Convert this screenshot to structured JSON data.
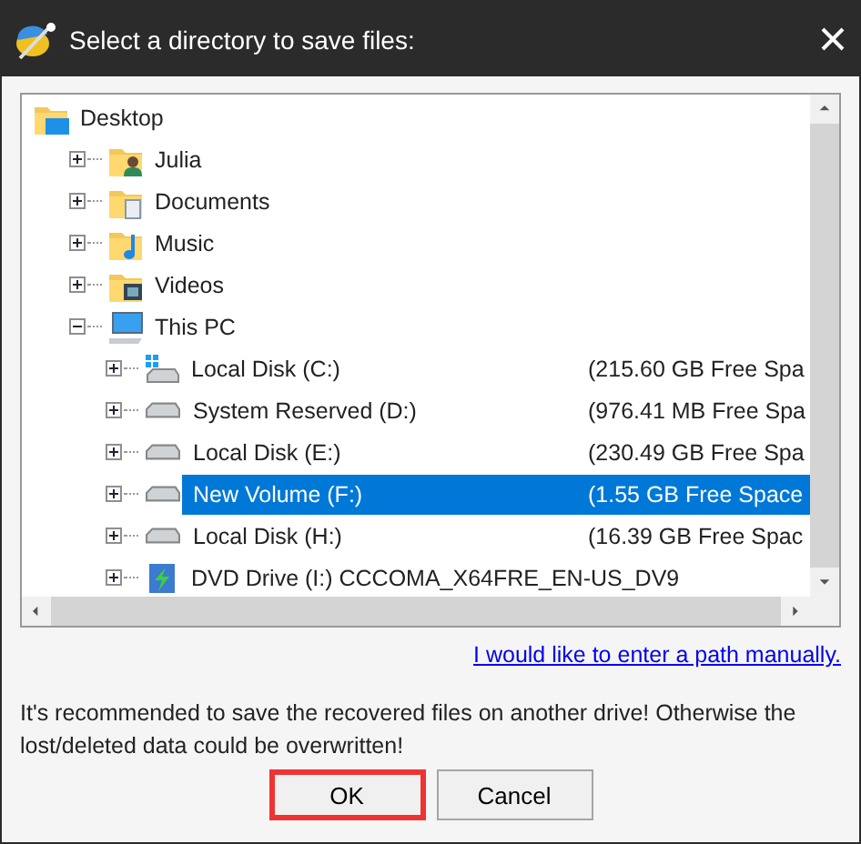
{
  "window": {
    "title": "Select a directory to save files:"
  },
  "tree": [
    {
      "kind": "desktop",
      "label": "Desktop",
      "selected": false,
      "children": [
        {
          "kind": "user",
          "label": "Julia",
          "expanded": false,
          "selected": false
        },
        {
          "kind": "documents",
          "label": "Documents",
          "expanded": false,
          "selected": false
        },
        {
          "kind": "music",
          "label": "Music",
          "expanded": false,
          "selected": false
        },
        {
          "kind": "videos",
          "label": "Videos",
          "expanded": false,
          "selected": false
        },
        {
          "kind": "pc",
          "label": "This PC",
          "expanded": true,
          "selected": false,
          "children": [
            {
              "kind": "system-drive",
              "label": "Local Disk (C:)",
              "free_space": "(215.60 GB Free Spa",
              "expanded": false,
              "selected": false
            },
            {
              "kind": "drive",
              "label": "System Reserved (D:)",
              "free_space": "(976.41 MB Free Spa",
              "expanded": false,
              "selected": false
            },
            {
              "kind": "drive",
              "label": "Local Disk (E:)",
              "free_space": "(230.49 GB Free Spa",
              "expanded": false,
              "selected": false
            },
            {
              "kind": "drive",
              "label": "New Volume (F:)",
              "free_space": "(1.55 GB Free Space",
              "expanded": false,
              "selected": true
            },
            {
              "kind": "drive",
              "label": "Local Disk (H:)",
              "free_space": "(16.39 GB Free Spac",
              "expanded": false,
              "selected": false
            },
            {
              "kind": "dvd",
              "label": "DVD Drive (I:) CCCOMA_X64FRE_EN-US_DV9",
              "expanded": false,
              "selected": false
            }
          ]
        }
      ]
    }
  ],
  "manual_path_link": "I would like to enter a path manually.",
  "warning": "It's recommended to save the recovered files on another drive! Otherwise the lost/deleted data could be overwritten!",
  "buttons": [
    {
      "label": "OK",
      "highlighted": true
    },
    {
      "label": "Cancel",
      "highlighted": false
    }
  ]
}
